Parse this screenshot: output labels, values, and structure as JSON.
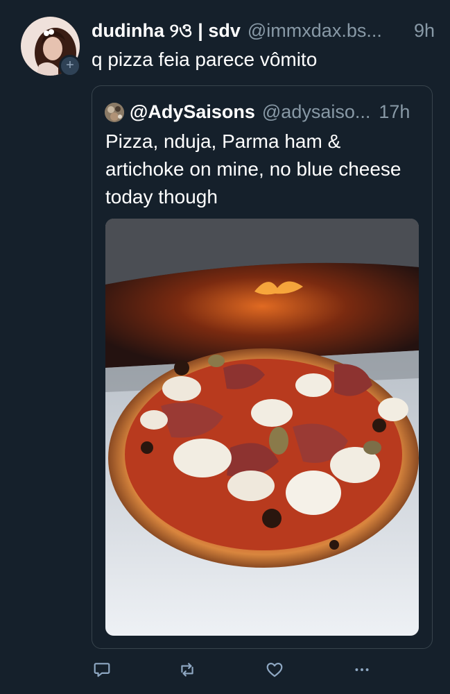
{
  "tweet": {
    "display_name": "dudinha ୨ও | sdv",
    "handle": "@immxdax.bs...",
    "time": "9h",
    "text": "q pizza feia parece vômito",
    "avatar_badge": "+"
  },
  "quote": {
    "display_name": "@AdySaisons",
    "handle": "@adysaiso...",
    "time": "17h",
    "text": "Pizza, nduja, Parma ham & artichoke on mine, no blue cheese today though"
  },
  "icons": {
    "reply": "reply-icon",
    "retweet": "retweet-icon",
    "like": "heart-icon",
    "more": "more-icon"
  },
  "colors": {
    "background": "#15202b",
    "border": "#38444d",
    "secondary_text": "#8899a6",
    "icon": "#8fa8c3"
  }
}
